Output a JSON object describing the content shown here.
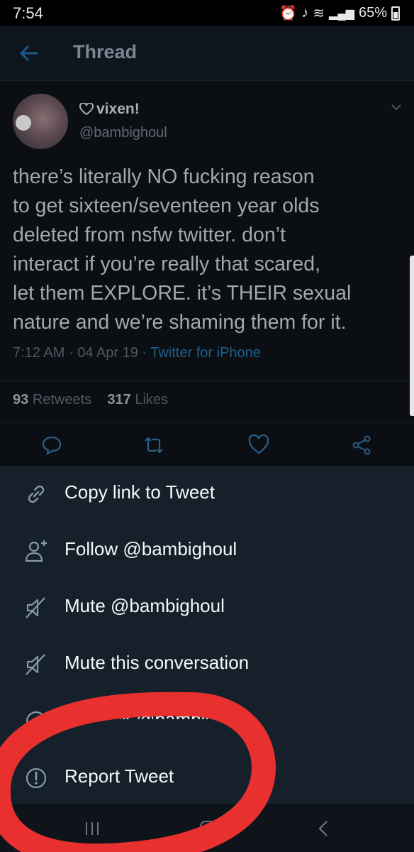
{
  "status_bar": {
    "time": "7:54",
    "battery": "65%"
  },
  "header": {
    "title": "Thread"
  },
  "tweet": {
    "display_name": "vixen!",
    "handle": "@bambighoul",
    "text_lines": [
      "there’s literally NO fucking reason",
      "to get sixteen/seventeen year olds",
      "deleted from nsfw twitter. don’t",
      "interact if you’re really that scared,",
      "let them EXPLORE. it’s THEIR sexual",
      "nature and we’re shaming them for it."
    ],
    "time": "7:12 AM",
    "date": "04 Apr 19",
    "separator": "·",
    "source": "Twitter for iPhone",
    "retweets_count": "93",
    "retweets_label": "Retweets",
    "likes_count": "317",
    "likes_label": "Likes"
  },
  "menu": {
    "items": [
      {
        "label": "Copy link to Tweet",
        "icon": "link-icon"
      },
      {
        "label": "Follow @bambighoul",
        "icon": "follow-user-icon"
      },
      {
        "label": "Mute @bambighoul",
        "icon": "mute-icon"
      },
      {
        "label": "Mute this conversation",
        "icon": "mute-icon"
      },
      {
        "label": "Unblock @bambighoul",
        "icon": "block-icon"
      },
      {
        "label": "Report Tweet",
        "icon": "report-icon"
      }
    ]
  },
  "colors": {
    "sheet_background": "#15202b",
    "accent": "#1da1f2",
    "annotation": "#e8312f"
  }
}
